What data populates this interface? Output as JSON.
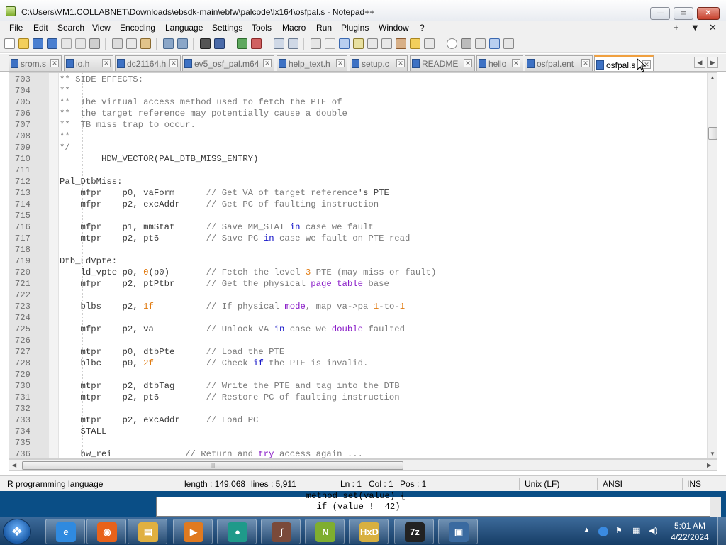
{
  "window": {
    "title": "C:\\Users\\VM1.COLLABNET\\Downloads\\ebsdk-main\\ebfw\\palcode\\lx164\\osfpal.s - Notepad++",
    "min_glyph": "—",
    "max_glyph": "▭",
    "close_glyph": "✕"
  },
  "menu": {
    "items": [
      "File",
      "Edit",
      "Search",
      "View",
      "Encoding",
      "Language",
      "Settings",
      "Tools",
      "Macro",
      "Run",
      "Plugins",
      "Window",
      "?"
    ],
    "right": [
      "+",
      "▼",
      "✕"
    ]
  },
  "tabs": [
    {
      "label": "srom.s",
      "active": false
    },
    {
      "label": "io.h",
      "active": false
    },
    {
      "label": "dc21164.h",
      "active": false
    },
    {
      "label": "ev5_osf_pal.m64",
      "active": false
    },
    {
      "label": "help_text.h",
      "active": false
    },
    {
      "label": "setup.c",
      "active": false
    },
    {
      "label": "README",
      "active": false
    },
    {
      "label": "hello",
      "active": false
    },
    {
      "label": "osfpal.ent",
      "active": false
    },
    {
      "label": "osfpal.s",
      "active": true
    }
  ],
  "tab_nav": [
    "◀",
    "▶"
  ],
  "editor": {
    "lines": [
      {
        "n": "703",
        "segs": [
          [
            "c",
            "** SIDE EFFECTS:"
          ]
        ]
      },
      {
        "n": "704",
        "segs": [
          [
            "c",
            "**"
          ]
        ]
      },
      {
        "n": "705",
        "segs": [
          [
            "c",
            "**  The virtual access method used to fetch the PTE of"
          ]
        ]
      },
      {
        "n": "706",
        "segs": [
          [
            "c",
            "**  the target reference may potentially cause a double"
          ]
        ]
      },
      {
        "n": "707",
        "segs": [
          [
            "c",
            "**  TB miss trap to occur."
          ]
        ]
      },
      {
        "n": "708",
        "segs": [
          [
            "c",
            "**"
          ]
        ]
      },
      {
        "n": "709",
        "segs": [
          [
            "c",
            "*/"
          ]
        ]
      },
      {
        "n": "710",
        "segs": [
          [
            "p",
            "        HDW_VECTOR(PAL_DTB_MISS_ENTRY)"
          ]
        ]
      },
      {
        "n": "711",
        "segs": []
      },
      {
        "n": "712",
        "segs": [
          [
            "p",
            "Pal_DtbMiss:"
          ]
        ]
      },
      {
        "n": "713",
        "segs": [
          [
            "p",
            "    mfpr    p0, vaForm      "
          ],
          [
            "c",
            "// Get VA of target reference"
          ],
          [
            "p",
            "'s PTE"
          ]
        ]
      },
      {
        "n": "714",
        "segs": [
          [
            "p",
            "    mfpr    p2, excAddr     "
          ],
          [
            "c",
            "// Get PC of faulting instruction"
          ]
        ]
      },
      {
        "n": "715",
        "segs": []
      },
      {
        "n": "716",
        "segs": [
          [
            "p",
            "    mfpr    p1, mmStat      "
          ],
          [
            "c",
            "// Save MM_STAT "
          ],
          [
            "k",
            "in"
          ],
          [
            "c",
            " case we fault"
          ]
        ]
      },
      {
        "n": "717",
        "segs": [
          [
            "p",
            "    mtpr    p2, pt6         "
          ],
          [
            "c",
            "// Save PC "
          ],
          [
            "k",
            "in"
          ],
          [
            "c",
            " case we fault on PTE read"
          ]
        ]
      },
      {
        "n": "718",
        "segs": []
      },
      {
        "n": "719",
        "segs": [
          [
            "p",
            "Dtb_LdVpte:"
          ]
        ]
      },
      {
        "n": "720",
        "segs": [
          [
            "p",
            "    ld_vpte p0, "
          ],
          [
            "n",
            "0"
          ],
          [
            "p",
            "(p0)       "
          ],
          [
            "c",
            "// Fetch the level "
          ],
          [
            "n",
            "3"
          ],
          [
            "c",
            " PTE (may miss or fault)"
          ]
        ]
      },
      {
        "n": "721",
        "segs": [
          [
            "p",
            "    mfpr    p2, ptPtbr      "
          ],
          [
            "c",
            "// Get the physical "
          ],
          [
            "u",
            "page table"
          ],
          [
            "c",
            " base"
          ]
        ]
      },
      {
        "n": "722",
        "segs": []
      },
      {
        "n": "723",
        "segs": [
          [
            "p",
            "    blbs    p2, "
          ],
          [
            "n",
            "1f"
          ],
          [
            "p",
            "          "
          ],
          [
            "c",
            "// If physical "
          ],
          [
            "u",
            "mode"
          ],
          [
            "c",
            ", map va->pa "
          ],
          [
            "n",
            "1"
          ],
          [
            "c",
            "-to-"
          ],
          [
            "n",
            "1"
          ]
        ]
      },
      {
        "n": "724",
        "segs": []
      },
      {
        "n": "725",
        "segs": [
          [
            "p",
            "    mfpr    p2, va          "
          ],
          [
            "c",
            "// Unlock VA "
          ],
          [
            "k",
            "in"
          ],
          [
            "c",
            " case we "
          ],
          [
            "u",
            "double"
          ],
          [
            "c",
            " faulted"
          ]
        ]
      },
      {
        "n": "726",
        "segs": []
      },
      {
        "n": "727",
        "segs": [
          [
            "p",
            "    mtpr    p0, dtbPte      "
          ],
          [
            "c",
            "// Load the PTE"
          ]
        ]
      },
      {
        "n": "728",
        "segs": [
          [
            "p",
            "    blbc    p0, "
          ],
          [
            "n",
            "2f"
          ],
          [
            "p",
            "          "
          ],
          [
            "c",
            "// Check "
          ],
          [
            "k",
            "if"
          ],
          [
            "c",
            " the PTE is invalid."
          ]
        ]
      },
      {
        "n": "729",
        "segs": []
      },
      {
        "n": "730",
        "segs": [
          [
            "p",
            "    mtpr    p2, dtbTag      "
          ],
          [
            "c",
            "// Write the PTE and tag into the DTB"
          ]
        ]
      },
      {
        "n": "731",
        "segs": [
          [
            "p",
            "    mtpr    p2, pt6         "
          ],
          [
            "c",
            "// Restore PC of faulting instruction"
          ]
        ]
      },
      {
        "n": "732",
        "segs": []
      },
      {
        "n": "733",
        "segs": [
          [
            "p",
            "    mtpr    p2, excAddr     "
          ],
          [
            "c",
            "// Load PC"
          ]
        ]
      },
      {
        "n": "734",
        "segs": [
          [
            "p",
            "    STALL"
          ]
        ]
      },
      {
        "n": "735",
        "segs": []
      },
      {
        "n": "736",
        "segs": [
          [
            "p",
            "    hw_rei              "
          ],
          [
            "c",
            "// Return and "
          ],
          [
            "u",
            "try"
          ],
          [
            "c",
            " access again ..."
          ]
        ]
      }
    ]
  },
  "scroll": {
    "up": "▲",
    "down": "▼",
    "left": "◀",
    "right": "▶",
    "grip": "|||"
  },
  "status": {
    "language": "R programming language",
    "length": "length : 149,068",
    "lines": "lines : 5,911",
    "ln": "Ln : 1",
    "col": "Col : 1",
    "pos": "Pos : 1",
    "eol": "Unix (LF)",
    "encoding": "ANSI",
    "mode": "INS"
  },
  "background_window": {
    "code_lines": [
      "  method set(value) {",
      "    if (value != 42)"
    ]
  },
  "taskbar": {
    "start_glyph": "❖",
    "apps": [
      {
        "name": "internet-explorer",
        "glyph": "e",
        "color": "#2f8ae0"
      },
      {
        "name": "firefox",
        "glyph": "◉",
        "color": "#e8621a"
      },
      {
        "name": "file-explorer",
        "glyph": "▤",
        "color": "#e0b040"
      },
      {
        "name": "media-player",
        "glyph": "▶",
        "color": "#e07a20"
      },
      {
        "name": "teal-app",
        "glyph": "●",
        "color": "#1f9a8a"
      },
      {
        "name": "curve-app",
        "glyph": "∫",
        "color": "#7a4a3a"
      },
      {
        "name": "notepad-plus-plus",
        "glyph": "N",
        "color": "#7fae2f"
      },
      {
        "name": "hxd-editor",
        "glyph": "HxD",
        "color": "#d8b040"
      },
      {
        "name": "7zip",
        "glyph": "7z",
        "color": "#222222"
      },
      {
        "name": "remote-desktop",
        "glyph": "▣",
        "color": "#3a6aa0"
      }
    ],
    "tray": {
      "arrow": "▲",
      "time": "5:01 AM",
      "date": "4/22/2024"
    }
  },
  "colors": {
    "accent_tab": "#f0a040",
    "comment": "#7a7a7a",
    "keyword": "#1515c8",
    "number": "#e07a10",
    "purple": "#8a1cc8"
  }
}
